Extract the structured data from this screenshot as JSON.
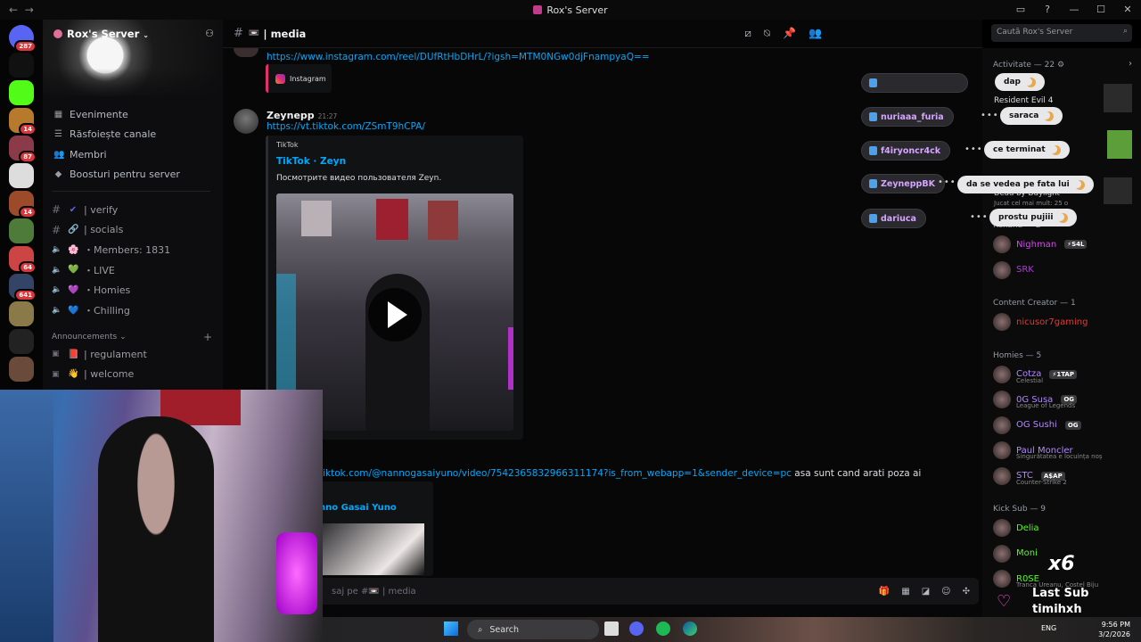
{
  "window": {
    "title": "Rox's Server",
    "nav_back": "←",
    "nav_fwd": "→"
  },
  "rail": {
    "servers": [
      {
        "name": "discord-home",
        "badge": "287",
        "color": "#5865f2"
      },
      {
        "name": "w-server",
        "badge": "",
        "color": "#111"
      },
      {
        "name": "kick-server",
        "badge": "",
        "color": "#53fc18"
      },
      {
        "name": "server-4",
        "badge": "14",
        "color": "#b7792b"
      },
      {
        "name": "server-5",
        "badge": "87",
        "color": "#8b3a4a"
      },
      {
        "name": "server-6",
        "badge": "",
        "color": "#ddd"
      },
      {
        "name": "server-7",
        "badge": "14",
        "color": "#9b4a2a"
      },
      {
        "name": "server-8",
        "badge": "",
        "color": "#4e7a3a"
      },
      {
        "name": "server-9",
        "badge": "64",
        "color": "#cc4444"
      },
      {
        "name": "server-10",
        "badge": "641",
        "color": "#334466"
      },
      {
        "name": "server-11",
        "badge": "",
        "color": "#8a7a4a"
      },
      {
        "name": "server-12",
        "badge": "",
        "color": "#222"
      },
      {
        "name": "server-13",
        "badge": "",
        "color": "#6a4a3a"
      }
    ]
  },
  "sidebar": {
    "server_name": "Rox's Server",
    "nav": [
      {
        "icon": "calendar-icon",
        "label": "Evenimente"
      },
      {
        "icon": "browse-icon",
        "label": "Răsfoiește canale"
      },
      {
        "icon": "members-icon",
        "label": "Membri"
      },
      {
        "icon": "boost-icon",
        "label": "Boosturi pentru server"
      }
    ],
    "channels": [
      {
        "type": "#",
        "emoji": "✔",
        "color": "#5865f2",
        "label": "| verify"
      },
      {
        "type": "#",
        "emoji": "🔗",
        "color": "#ddd",
        "label": "| socials"
      },
      {
        "type": "🔊",
        "emoji": "🌸",
        "color": "#f08080",
        "label": "・Members: 1831"
      },
      {
        "type": "🔊",
        "emoji": "💚",
        "color": "#3ba55d",
        "label": "・LIVE"
      },
      {
        "type": "🔊",
        "emoji": "💜",
        "color": "#9b59b6",
        "label": "・Homies"
      },
      {
        "type": "🔊",
        "emoji": "💙",
        "color": "#5d8df0",
        "label": "・Chilling"
      }
    ],
    "category": "Announcements",
    "announcements": [
      {
        "type": "📕",
        "label": "| regulament"
      },
      {
        "type": "👋",
        "label": "| welcome"
      }
    ]
  },
  "main": {
    "channel_title": "| media",
    "search_placeholder": "Caută Rox's Server",
    "messages": [
      {
        "link": "https://www.instagram.com/reel/DUfRtHbDHrL/?igsh=MTM0NGw0djFnampyaQ==",
        "embed_label": "Instagram"
      },
      {
        "author": "Zeynepp",
        "time": "21:27",
        "link": "https://vt.tiktok.com/ZSmT9hCPA/",
        "embed_provider": "TikTok",
        "embed_title": "TikTok · Zeyn",
        "embed_desc": "Посмотрите видео пользователя Zeyn."
      },
      {
        "link": "tiktok.com/@nannogasaiyuno/video/7542365832966311174?is_from_webapp=1&sender_device=pc",
        "text": "asa sunt cand arati poza ai",
        "embed_title": "nno Gasai Yuno"
      }
    ],
    "composer_placeholder": "saj pe #📼 | media"
  },
  "alerts": [
    {
      "name": "nuriaaa_furia",
      "msg": "saraca"
    },
    {
      "name": "f4iryoncr4ck",
      "msg": "ce terminat"
    },
    {
      "name": "ZeyneppBK",
      "msg": "da se vedea pe fata lui"
    },
    {
      "name": "dariuca",
      "msg": "prostu pujiii"
    },
    {
      "name": "",
      "msg": "dap"
    }
  ],
  "members": {
    "activity_header": "Activitate — 22",
    "activity_game": "Resident Evil 4",
    "activity_game2": "Dead by Daylight",
    "activity_game2_sub": "Jucat cel mai mult: 25 o",
    "sections": [
      {
        "title": "Roxana — 2",
        "items": [
          {
            "name": "Nighman",
            "tag": "⚡S4L",
            "color": "#e040fb"
          },
          {
            "name": "SRK",
            "tag": "",
            "color": "#b03ad8"
          }
        ]
      },
      {
        "title": "Content Creator — 1",
        "items": [
          {
            "name": "nicusor7gaming",
            "tag": "",
            "color": "#e53935"
          }
        ]
      },
      {
        "title": "Homies — 5",
        "items": [
          {
            "name": "Cotza",
            "tag": "⚡1TAP",
            "sub": "Celestial",
            "color": "#b388ff"
          },
          {
            "name": "0G Susa",
            "tag": "OG",
            "sub": "League of Legends",
            "color": "#b388ff"
          },
          {
            "name": "OG Sushi",
            "tag": "OG",
            "sub": "",
            "color": "#b388ff"
          },
          {
            "name": "Paul Moncler",
            "tag": "",
            "sub": "Singurătatea e locuința noș",
            "color": "#b388ff"
          },
          {
            "name": "STC",
            "tag": "A$AP",
            "sub": "Counter-Strike 2",
            "color": "#b388ff"
          }
        ]
      },
      {
        "title": "Kick Sub — 9",
        "items": [
          {
            "name": "Delia",
            "tag": "",
            "color": "#53fc18"
          },
          {
            "name": "Moni",
            "tag": "",
            "color": "#53fc18"
          },
          {
            "name": "R0SE",
            "tag": "",
            "sub": "Tranca Ureanu, Costel Biju",
            "color": "#53fc18"
          }
        ]
      }
    ]
  },
  "overlay": {
    "multiplier": "x6",
    "title": "Last Sub",
    "user": "timihxh"
  },
  "taskbar": {
    "search": "Search",
    "lang": "ENG",
    "time": "9:56 PM",
    "date": "3/2/2026"
  }
}
